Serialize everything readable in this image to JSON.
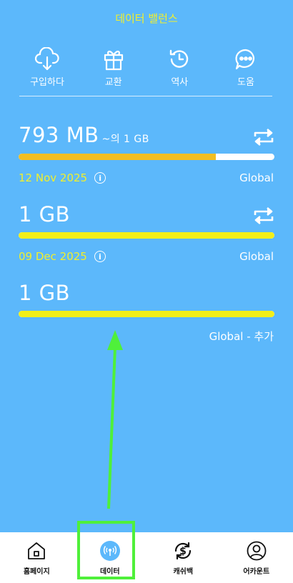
{
  "header": {
    "title": "데이터 밸런스"
  },
  "actions": [
    {
      "label": "구입하다",
      "icon": "cloud-download-icon"
    },
    {
      "label": "교환",
      "icon": "gift-icon"
    },
    {
      "label": "역사",
      "icon": "history-icon"
    },
    {
      "label": "도움",
      "icon": "chat-help-icon"
    }
  ],
  "plans": [
    {
      "amount": "793 MB",
      "total_suffix": "~의 1 GB",
      "progress": 0.77,
      "bar_color": "#f2be22",
      "date": "12 Nov 2025",
      "region": "Global"
    },
    {
      "amount": "1 GB",
      "progress": 1.0,
      "bar_color": "#f2ef18",
      "date": "09 Dec 2025",
      "region": "Global"
    },
    {
      "amount": "1 GB",
      "progress": 1.0,
      "bar_color": "#f2ef18",
      "region": "Global - 추가"
    }
  ],
  "nav": [
    {
      "label": "홈페이지",
      "icon": "home-icon"
    },
    {
      "label": "데이터",
      "icon": "signal-icon",
      "active": true
    },
    {
      "label": "캐쉬백",
      "icon": "cashback-icon"
    },
    {
      "label": "어카운트",
      "icon": "account-icon"
    }
  ],
  "colors": {
    "background": "#5cb8fb",
    "accent_yellow": "#f2ef2a",
    "highlight": "#4ff03a"
  }
}
